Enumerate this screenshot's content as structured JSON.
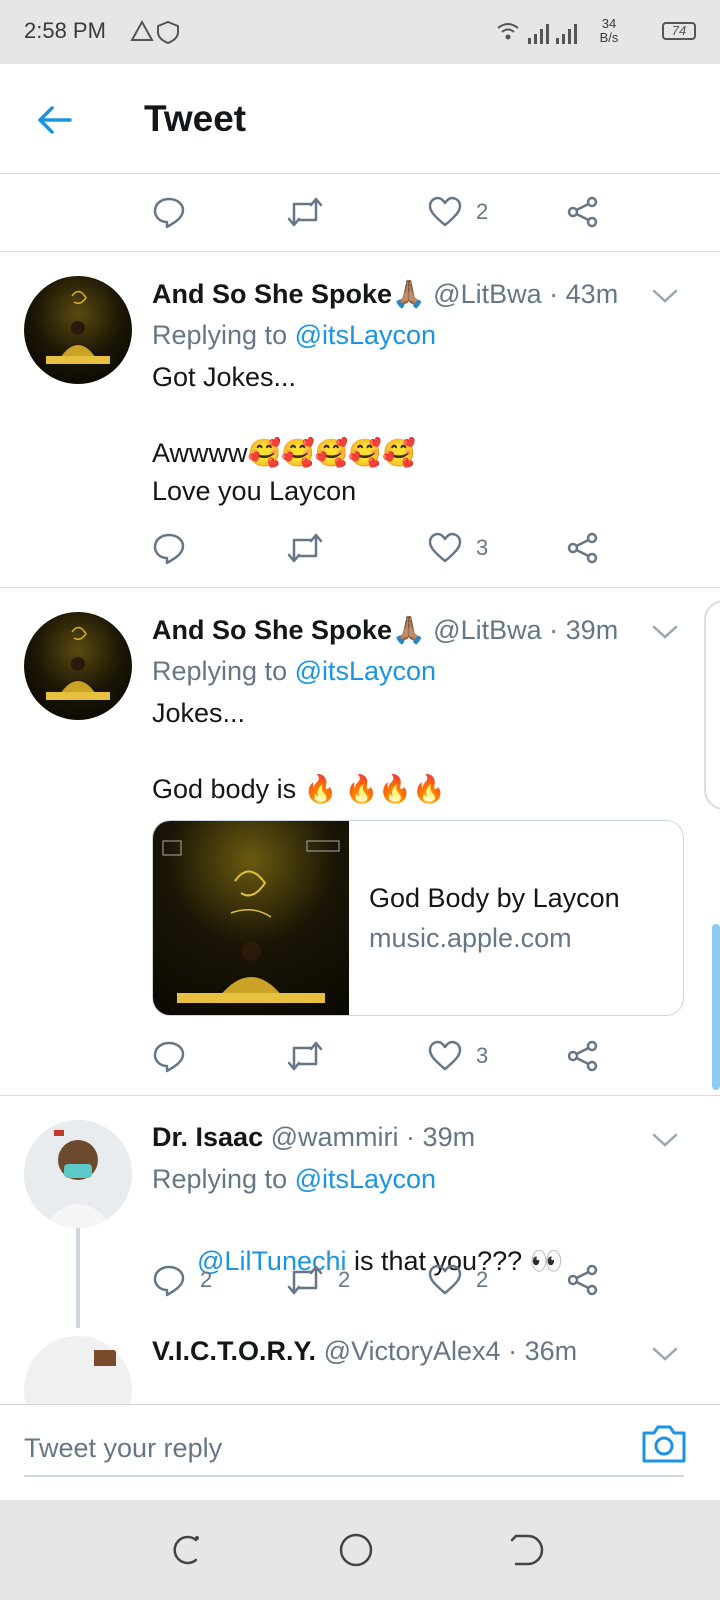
{
  "status_bar": {
    "time": "2:58 PM",
    "speed_value": "34",
    "speed_unit": "B/s",
    "battery": "74"
  },
  "header": {
    "title": "Tweet"
  },
  "top_actions": {
    "like_count": "2"
  },
  "tweets": [
    {
      "name": "And So She Spoke🙏🏽",
      "handle": "@LitBwa",
      "time": "43m",
      "replying_prefix": "Replying to ",
      "replying_to": "@itsLaycon",
      "body": "Got Jokes...\n\nAwwww🥰🥰🥰🥰🥰\nLove you Laycon",
      "reply_count": "",
      "retweet_count": "",
      "like_count": "3"
    },
    {
      "name": "And So She Spoke🙏🏽",
      "handle": "@LitBwa",
      "time": "39m",
      "replying_prefix": "Replying to ",
      "replying_to": "@itsLaycon",
      "body": "Jokes...\n\nGod body is 🔥 🔥🔥🔥",
      "card": {
        "title": "God Body by Laycon",
        "url": "music.apple.com"
      },
      "reply_count": "",
      "retweet_count": "",
      "like_count": "3"
    },
    {
      "name": "Dr. Isaac",
      "handle": "@wammiri",
      "time": "39m",
      "replying_prefix": "Replying to ",
      "replying_to": "@itsLaycon",
      "body_mention": "@LilTunechi",
      "body_text": " is that you??? 👀",
      "reply_count": "2",
      "retweet_count": "2",
      "like_count": "2"
    },
    {
      "name": "V.I.C.T.O.R.Y.",
      "handle": "@VictoryAlex4",
      "time": "36m"
    }
  ],
  "reply_bar": {
    "placeholder": "Tweet your reply"
  },
  "colors": {
    "accent": "#1b95e0",
    "muted": "#657786",
    "text": "#14171a"
  }
}
